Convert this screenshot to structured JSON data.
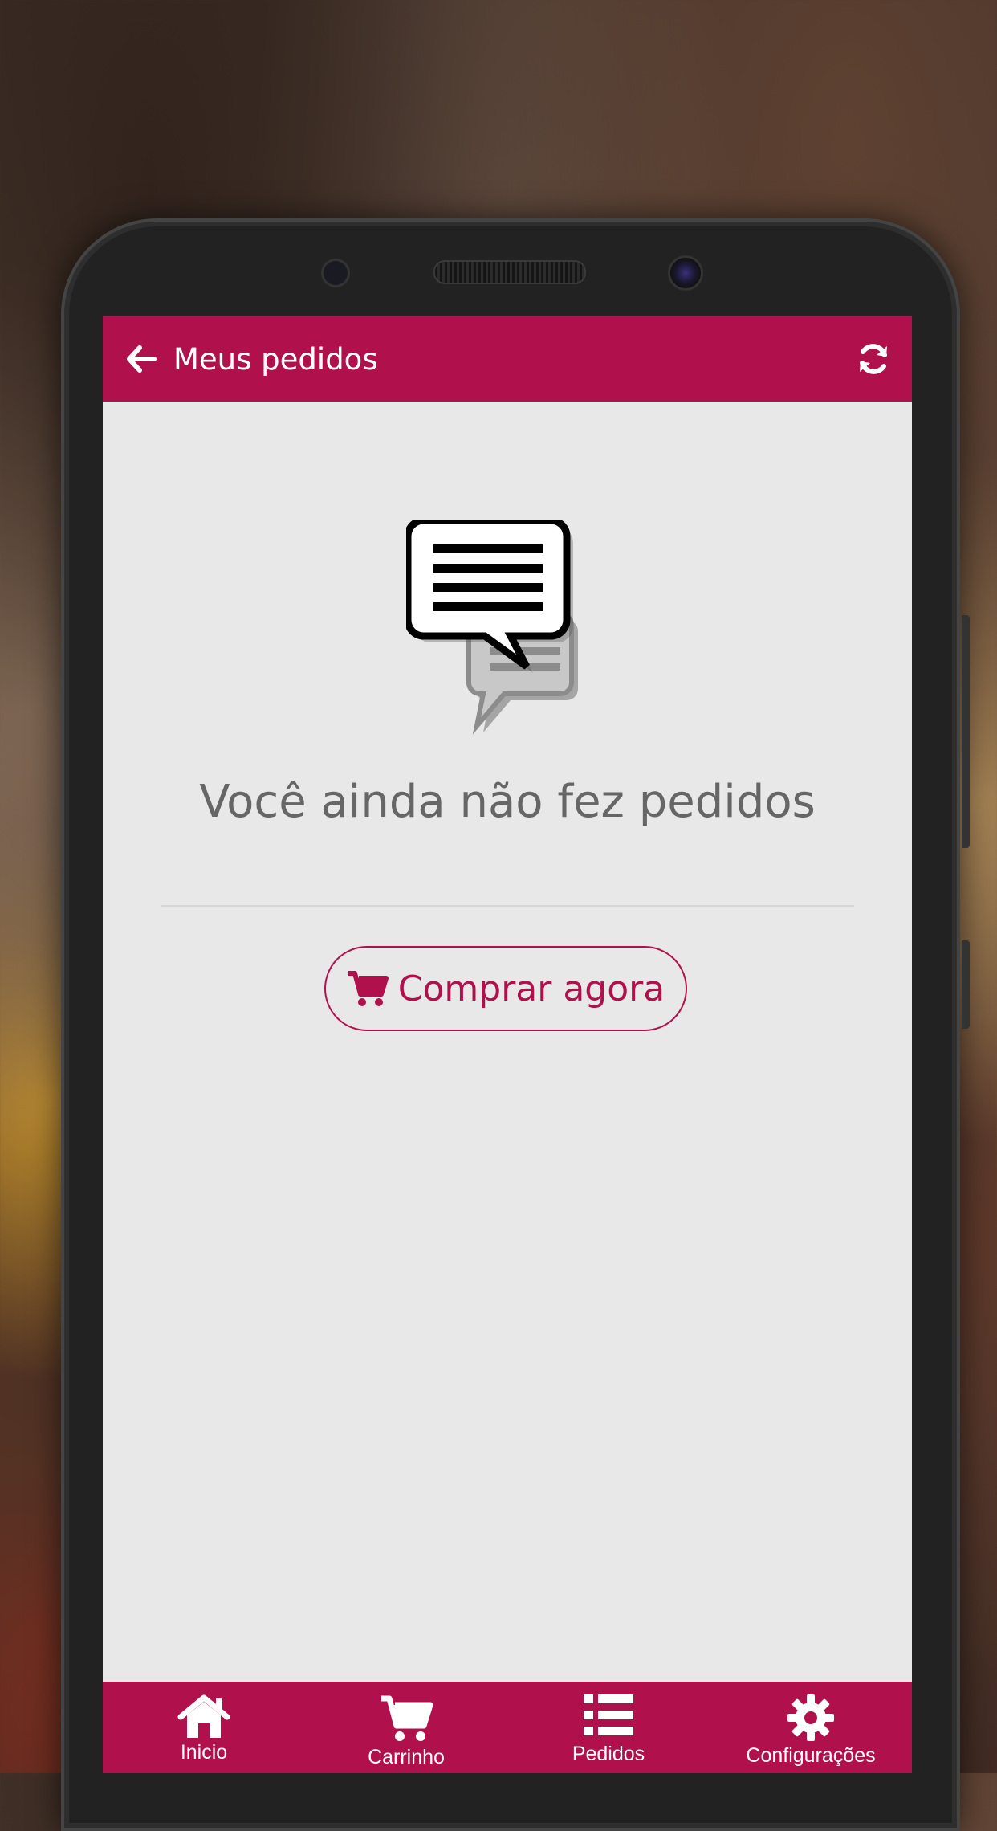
{
  "header": {
    "title": "Meus pedidos",
    "back_icon": "arrow-left-icon",
    "refresh_icon": "refresh-icon"
  },
  "empty_state": {
    "icon": "chat-bubbles-icon",
    "message": "Você ainda não fez pedidos",
    "button_label": "Comprar agora",
    "button_icon": "cart-icon"
  },
  "bottom_nav": {
    "items": [
      {
        "label": "Inicio",
        "icon": "home-icon"
      },
      {
        "label": "Carrinho",
        "icon": "cart-icon"
      },
      {
        "label": "Pedidos",
        "icon": "list-icon",
        "active": true
      },
      {
        "label": "Configurações",
        "icon": "gear-icon"
      }
    ]
  },
  "colors": {
    "primary": "#b0114d",
    "background": "#e8e8e8",
    "text_muted": "#666666"
  }
}
